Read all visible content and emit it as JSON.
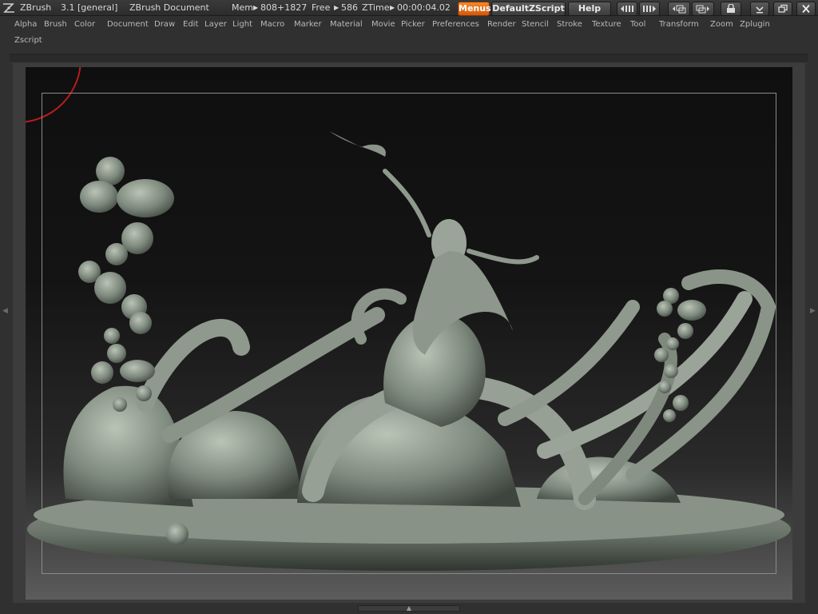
{
  "titlebar": {
    "app_name": "ZBrush",
    "version": "3.1 [general]",
    "document_title": "ZBrush Document",
    "mem_label": "Mem",
    "mem_value": "808+1827",
    "free_label": "Free",
    "free_value": "586",
    "ztime_label": "ZTime",
    "ztime_value": "00:00:04.02",
    "menus_button": "Menus",
    "script_button": "DefaultZScript",
    "help_button": "Help"
  },
  "menubar": {
    "row1": [
      "Alpha",
      "Brush",
      "Color",
      "Document",
      "Draw",
      "Edit",
      "Layer",
      "Light",
      "Macro",
      "Marker",
      "Material",
      "Movie",
      "Picker",
      "Preferences",
      "Render",
      "Stencil",
      "Stroke",
      "Texture",
      "Tool",
      "Transform",
      "Zoom",
      "Zplugin"
    ],
    "row2": [
      "Zscript"
    ]
  },
  "icons": {
    "logo": "zbrush-logo-icon",
    "tray_left": "tray-collapse-left-icon",
    "tray_right": "tray-collapse-right-icon",
    "layout_1": "layout-icon",
    "layout_2": "layout-alt-icon",
    "lock": "lock-icon",
    "minimize": "minimize-icon",
    "restore": "restore-icon",
    "close": "close-icon"
  },
  "colors": {
    "accent": "#e8741c",
    "background": "#303030",
    "cursor_ring": "#b81c1c",
    "sculpt": "#8e9a8d"
  }
}
